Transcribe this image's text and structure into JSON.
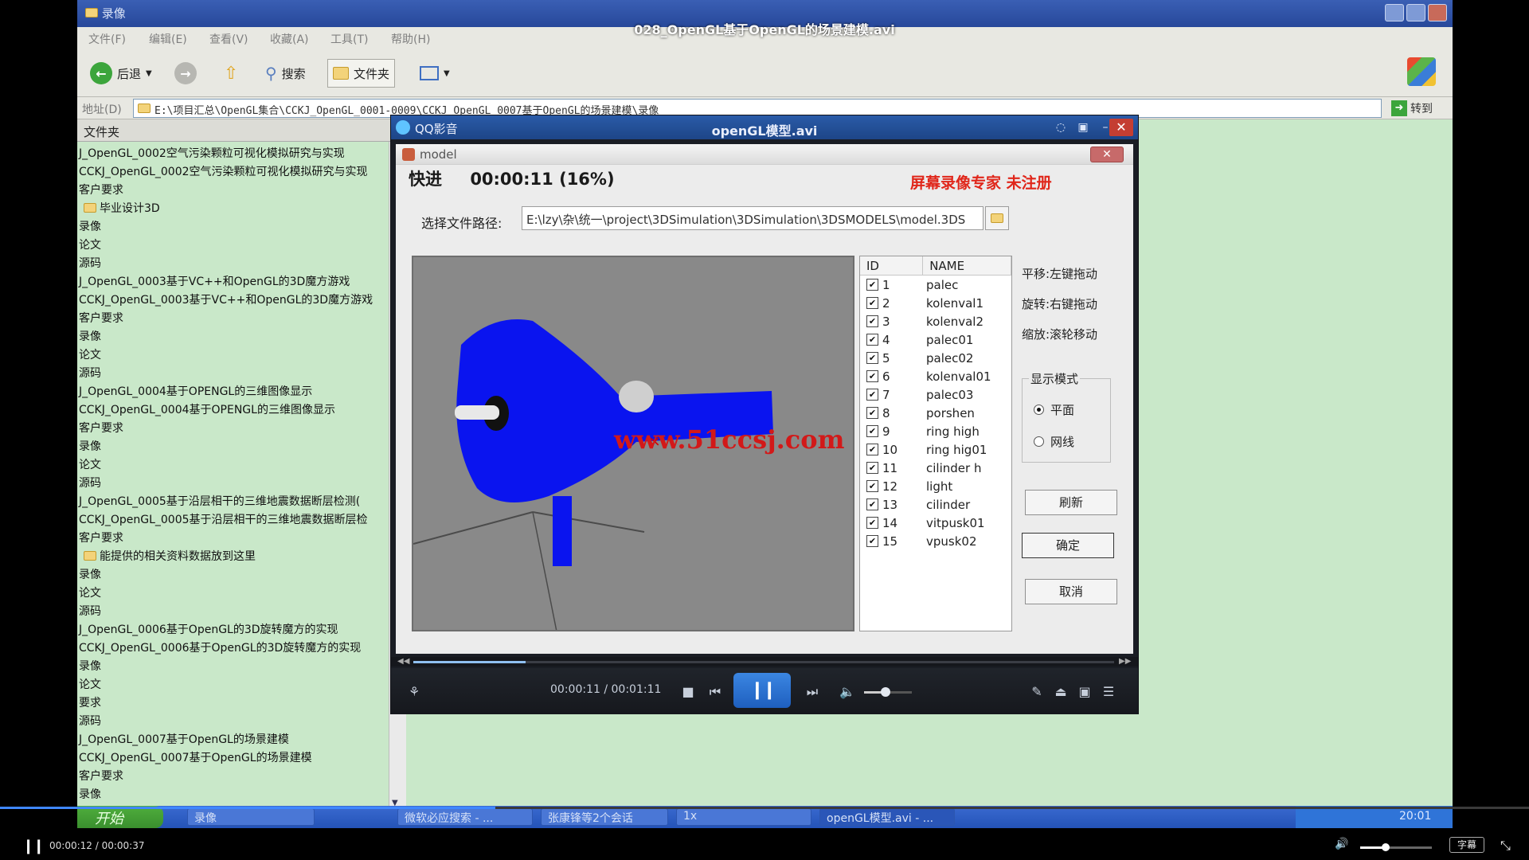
{
  "video_title": "028_OpenGL基于OpenGL的场景建模.avi",
  "explorer": {
    "window_title": "录像",
    "menu": [
      "文件(F)",
      "编辑(E)",
      "查看(V)",
      "收藏(A)",
      "工具(T)",
      "帮助(H)"
    ],
    "toolbar": {
      "back": "后退",
      "search": "搜索",
      "folders": "文件夹"
    },
    "address_label": "地址(D)",
    "address": "E:\\项目汇总\\OpenGL集合\\CCKJ_OpenGL_0001-0009\\CCKJ_OpenGL_0007基于OpenGL的场景建模\\录像",
    "go_label": "转到",
    "folder_pane_title": "文件夹",
    "tree": [
      {
        "text": "J_OpenGL_0002空气污染颗粒可视化模拟研究与实现",
        "folder": false
      },
      {
        "text": "CCKJ_OpenGL_0002空气污染颗粒可视化模拟研究与实现",
        "folder": false
      },
      {
        "text": "客户要求",
        "folder": false
      },
      {
        "text": "毕业设计3D",
        "folder": true
      },
      {
        "text": "录像",
        "folder": false
      },
      {
        "text": "论文",
        "folder": false
      },
      {
        "text": "源码",
        "folder": false
      },
      {
        "text": "J_OpenGL_0003基于VC++和OpenGL的3D魔方游戏",
        "folder": false
      },
      {
        "text": "CCKJ_OpenGL_0003基于VC++和OpenGL的3D魔方游戏",
        "folder": false
      },
      {
        "text": "客户要求",
        "folder": false
      },
      {
        "text": "录像",
        "folder": false
      },
      {
        "text": "论文",
        "folder": false
      },
      {
        "text": "源码",
        "folder": false
      },
      {
        "text": "J_OpenGL_0004基于OPENGL的三维图像显示",
        "folder": false
      },
      {
        "text": "CCKJ_OpenGL_0004基于OPENGL的三维图像显示",
        "folder": false
      },
      {
        "text": "客户要求",
        "folder": false
      },
      {
        "text": "录像",
        "folder": false
      },
      {
        "text": "论文",
        "folder": false
      },
      {
        "text": "源码",
        "folder": false
      },
      {
        "text": "J_OpenGL_0005基于沿层相干的三维地震数据断层检测(",
        "folder": false
      },
      {
        "text": "CCKJ_OpenGL_0005基于沿层相干的三维地震数据断层检",
        "folder": false
      },
      {
        "text": "客户要求",
        "folder": false
      },
      {
        "text": "能提供的相关资料数据放到这里",
        "folder": true
      },
      {
        "text": "录像",
        "folder": false
      },
      {
        "text": "论文",
        "folder": false
      },
      {
        "text": "源码",
        "folder": false
      },
      {
        "text": "J_OpenGL_0006基于OpenGL的3D旋转魔方的实现",
        "folder": false
      },
      {
        "text": "CCKJ_OpenGL_0006基于OpenGL的3D旋转魔方的实现",
        "folder": false
      },
      {
        "text": "录像",
        "folder": false
      },
      {
        "text": "论文",
        "folder": false
      },
      {
        "text": "要求",
        "folder": false
      },
      {
        "text": "源码",
        "folder": false
      },
      {
        "text": "J_OpenGL_0007基于OpenGL的场景建模",
        "folder": false
      },
      {
        "text": "CCKJ_OpenGL_0007基于OpenGL的场景建模",
        "folder": false
      },
      {
        "text": "客户要求",
        "folder": false
      },
      {
        "text": "录像",
        "folder": false
      }
    ]
  },
  "taskbar": {
    "start": "开始",
    "tasks": [
      "录像",
      "微软必应搜索 - ...",
      "张康锋等2个会话",
      "1x",
      "openGL模型.avi - ..."
    ],
    "clock": "20:01"
  },
  "qq_player": {
    "app_name": "QQ影音",
    "file_title": "openGL模型.avi",
    "current_time": "00:00:11",
    "total_time": "00:01:11",
    "seek_fraction": 0.16,
    "volume_fraction": 0.45
  },
  "model_dialog": {
    "title": "model",
    "status_label": "快进",
    "status_time": "00:00:11 (16%)",
    "watermark": "屏幕录像专家 未注册",
    "path_label": "选择文件路径:",
    "path_value": "E:\\lzy\\杂\\统一\\project\\3DSimulation\\3DSimulation\\3DSMODELS\\model.3DS",
    "viewport_watermark": "www.51ccsj.com",
    "list_headers": [
      "ID",
      "NAME"
    ],
    "rows": [
      {
        "id": "1",
        "name": "palec",
        "checked": true
      },
      {
        "id": "2",
        "name": "kolenval1",
        "checked": true
      },
      {
        "id": "3",
        "name": "kolenval2",
        "checked": true
      },
      {
        "id": "4",
        "name": "palec01",
        "checked": true
      },
      {
        "id": "5",
        "name": "palec02",
        "checked": true
      },
      {
        "id": "6",
        "name": "kolenval01",
        "checked": true
      },
      {
        "id": "7",
        "name": "palec03",
        "checked": true
      },
      {
        "id": "8",
        "name": "porshen",
        "checked": true
      },
      {
        "id": "9",
        "name": "ring high",
        "checked": true
      },
      {
        "id": "10",
        "name": "ring hig01",
        "checked": true
      },
      {
        "id": "11",
        "name": "cilinder h",
        "checked": true
      },
      {
        "id": "12",
        "name": "light",
        "checked": true
      },
      {
        "id": "13",
        "name": "cilinder",
        "checked": true
      },
      {
        "id": "14",
        "name": "vitpusk01",
        "checked": true
      },
      {
        "id": "15",
        "name": "vpusk02",
        "checked": true
      }
    ],
    "hints": [
      "平移:左键拖动",
      "旋转:右键拖动",
      "缩放:滚轮移动"
    ],
    "display_mode": {
      "label": "显示模式",
      "options": [
        "平面",
        "网线"
      ],
      "selected": 0
    },
    "buttons": {
      "refresh": "刷新",
      "ok": "确定",
      "cancel": "取消"
    }
  },
  "outer_player": {
    "time": "00:00:12 / 00:00:37",
    "progress_fraction": 0.324,
    "volume_fraction": 0.35,
    "subtitle": "字幕"
  }
}
